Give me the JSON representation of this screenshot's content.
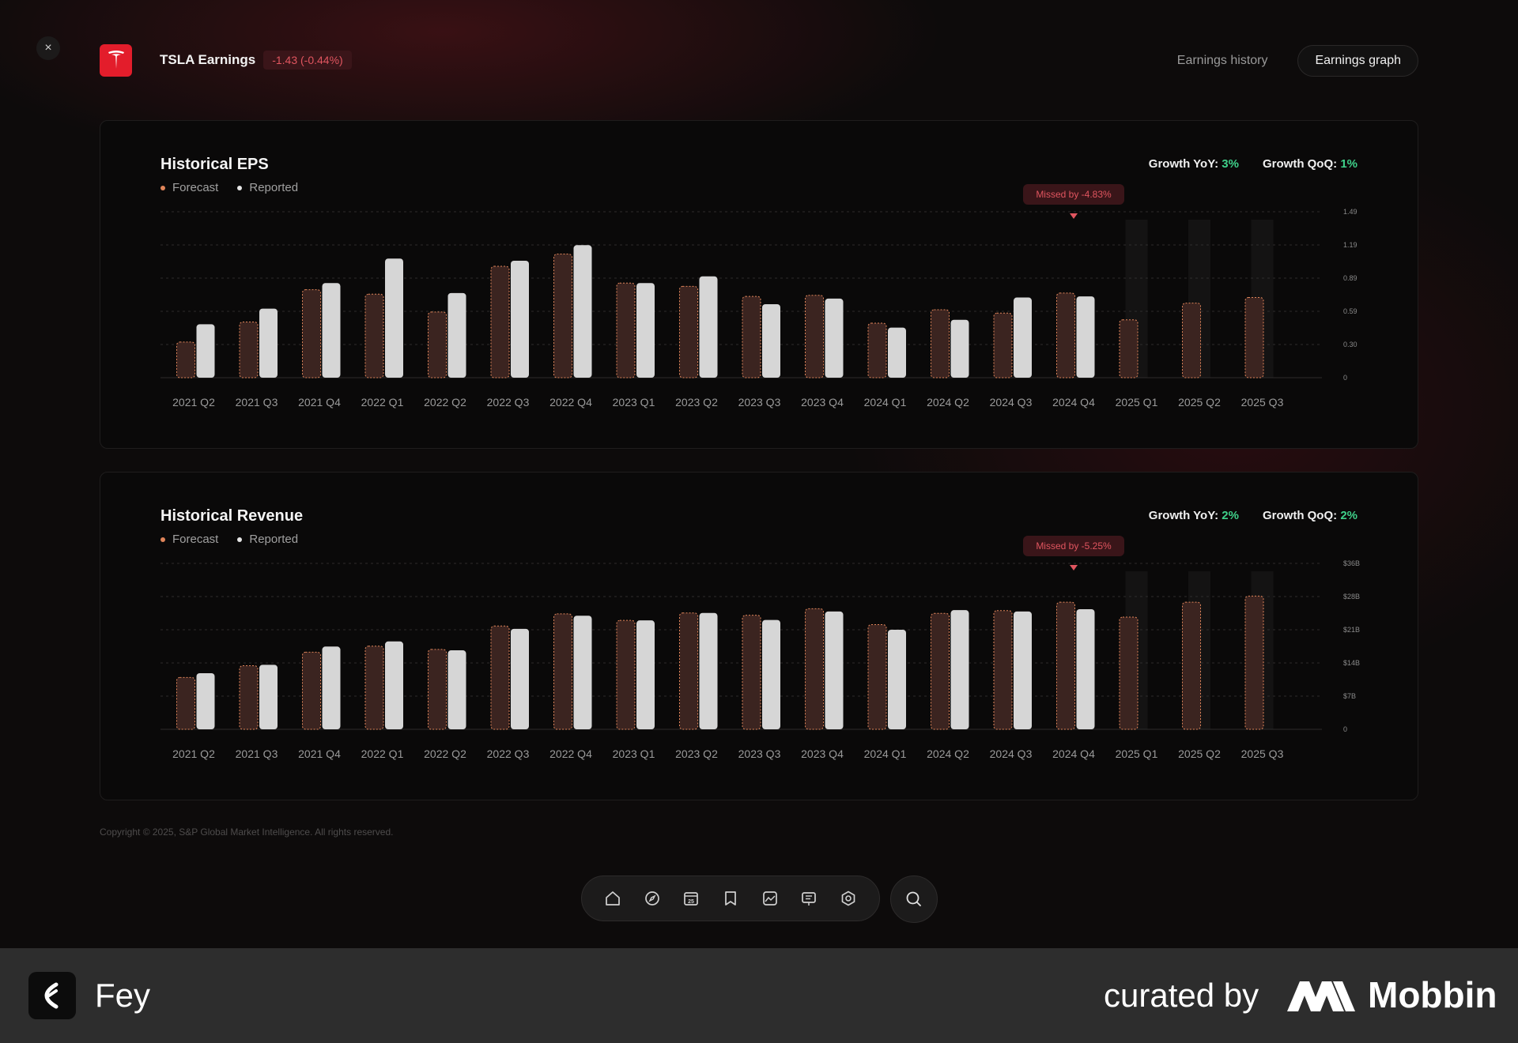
{
  "header": {
    "close_label": "×",
    "ticker_title": "TSLA Earnings",
    "change": "-1.43 (-0.44%)",
    "nav": {
      "history": "Earnings history",
      "graph": "Earnings graph"
    }
  },
  "colors": {
    "forecast_fill": "#3b2420",
    "forecast_outline": "#e0855a",
    "reported_fill": "#d6d6d6",
    "growth_positive": "#3fd18a",
    "brand_red": "#e31d2b",
    "miss_badge_text": "#e0555f",
    "miss_badge_bg": "#3a1519"
  },
  "legend": {
    "forecast": "Forecast",
    "reported": "Reported"
  },
  "eps": {
    "title": "Historical EPS",
    "growth_yoy_label": "Growth YoY:",
    "growth_yoy": "3%",
    "growth_qoq_label": "Growth QoQ:",
    "growth_qoq": "1%",
    "miss": "Missed by -4.83%"
  },
  "revenue": {
    "title": "Historical Revenue",
    "growth_yoy_label": "Growth YoY:",
    "growth_yoy": "2%",
    "growth_qoq_label": "Growth QoQ:",
    "growth_qoq": "2%",
    "miss": "Missed by -5.25%"
  },
  "chart_data": [
    {
      "type": "bar",
      "title": "Historical EPS",
      "categories": [
        "2021 Q2",
        "2021 Q3",
        "2021 Q4",
        "2022 Q1",
        "2022 Q2",
        "2022 Q3",
        "2022 Q4",
        "2023 Q1",
        "2023 Q2",
        "2023 Q3",
        "2023 Q4",
        "2024 Q1",
        "2024 Q2",
        "2024 Q3",
        "2024 Q4",
        "2025 Q1",
        "2025 Q2",
        "2025 Q3"
      ],
      "series": [
        {
          "name": "Forecast",
          "values": [
            0.32,
            0.5,
            0.79,
            0.75,
            0.59,
            1.0,
            1.11,
            0.85,
            0.82,
            0.73,
            0.74,
            0.49,
            0.61,
            0.58,
            0.76,
            0.52,
            0.67,
            0.72
          ]
        },
        {
          "name": "Reported",
          "values": [
            0.48,
            0.62,
            0.85,
            1.07,
            0.76,
            1.05,
            1.19,
            0.85,
            0.91,
            0.66,
            0.71,
            0.45,
            0.52,
            0.72,
            0.73,
            null,
            null,
            null
          ]
        }
      ],
      "ytick_labels": [
        "0",
        "0.30",
        "0.59",
        "0.89",
        "1.19",
        "1.49"
      ],
      "ylim": [
        0,
        1.49
      ],
      "grid": true,
      "highlight": {
        "category": "2024 Q4",
        "label": "Missed by -4.83%"
      }
    },
    {
      "type": "bar",
      "title": "Historical Revenue",
      "categories": [
        "2021 Q2",
        "2021 Q3",
        "2021 Q4",
        "2022 Q1",
        "2022 Q2",
        "2022 Q3",
        "2022 Q4",
        "2023 Q1",
        "2023 Q2",
        "2023 Q3",
        "2023 Q4",
        "2024 Q1",
        "2024 Q2",
        "2024 Q3",
        "2024 Q4",
        "2025 Q1",
        "2025 Q2",
        "2025 Q3"
      ],
      "series": [
        {
          "name": "Forecast",
          "values": [
            11.1,
            13.6,
            16.5,
            17.8,
            17.1,
            22.1,
            24.7,
            23.3,
            24.9,
            24.4,
            25.8,
            22.4,
            24.8,
            25.4,
            27.2,
            24.0,
            27.2,
            28.5
          ]
        },
        {
          "name": "Reported",
          "values": [
            12.0,
            13.8,
            17.7,
            18.8,
            16.9,
            21.5,
            24.3,
            23.3,
            24.9,
            23.4,
            25.2,
            21.3,
            25.5,
            25.2,
            25.7,
            null,
            null,
            null
          ]
        }
      ],
      "ytick_labels": [
        "0",
        "$7B",
        "$14B",
        "$21B",
        "$28B",
        "$36B"
      ],
      "ylim": [
        0,
        35.5
      ],
      "grid": true,
      "highlight": {
        "category": "2024 Q4",
        "label": "Missed by -5.25%"
      }
    }
  ],
  "footer": {
    "copyright": "Copyright © 2025, S&P Global Market Intelligence. All rights reserved."
  },
  "dock": {
    "icons": [
      "home-icon",
      "compass-icon",
      "calendar-icon",
      "bookmark-icon",
      "chart-image-icon",
      "presentation-icon",
      "settings-icon"
    ],
    "calendar_day": "25",
    "search_icon": "search-icon"
  },
  "brand_bar": {
    "app_name": "Fey",
    "curated_by": "curated by",
    "mobbin": "Mobbin"
  }
}
